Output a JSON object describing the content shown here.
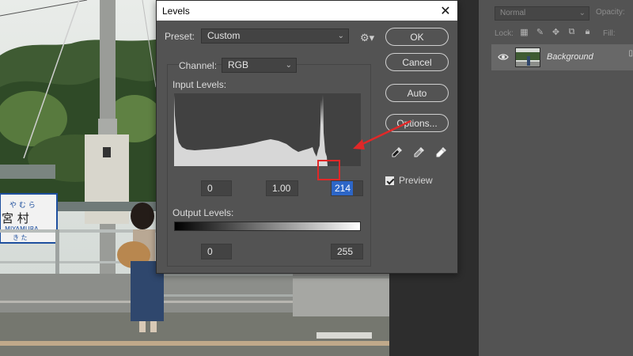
{
  "dialog": {
    "title": "Levels",
    "preset_label": "Preset:",
    "preset_value": "Custom",
    "channel_label": "Channel:",
    "channel_value": "RGB",
    "input_levels_label": "Input Levels:",
    "output_levels_label": "Output Levels:",
    "input_values": {
      "black": "0",
      "gamma": "1.00",
      "white": "214"
    },
    "output_values": {
      "black": "0",
      "white": "255"
    },
    "buttons": {
      "ok": "OK",
      "cancel": "Cancel",
      "auto": "Auto",
      "options": "Options..."
    },
    "preview_label": "Preview",
    "preview_checked": true
  },
  "layers_panel": {
    "blend_mode": "Normal",
    "opacity_label": "Opacity:",
    "lock_label": "Lock:",
    "fill_label": "Fill:",
    "layer_name": "Background"
  },
  "photo_sign": {
    "kana_top": "や む ら",
    "kanji": "宮  村",
    "romaji": "MIYAMURA",
    "kana_bottom": "き  た"
  },
  "colors": {
    "dialog_bg": "#535353",
    "accent_selection": "#2d66c7",
    "annotation_red": "#e12828"
  },
  "icons": {
    "close": "close-icon",
    "gear": "gear-icon",
    "eyedropper_black": "eyedropper-black-icon",
    "eyedropper_gray": "eyedropper-gray-icon",
    "eyedropper_white": "eyedropper-white-icon",
    "eye": "eye-icon"
  }
}
